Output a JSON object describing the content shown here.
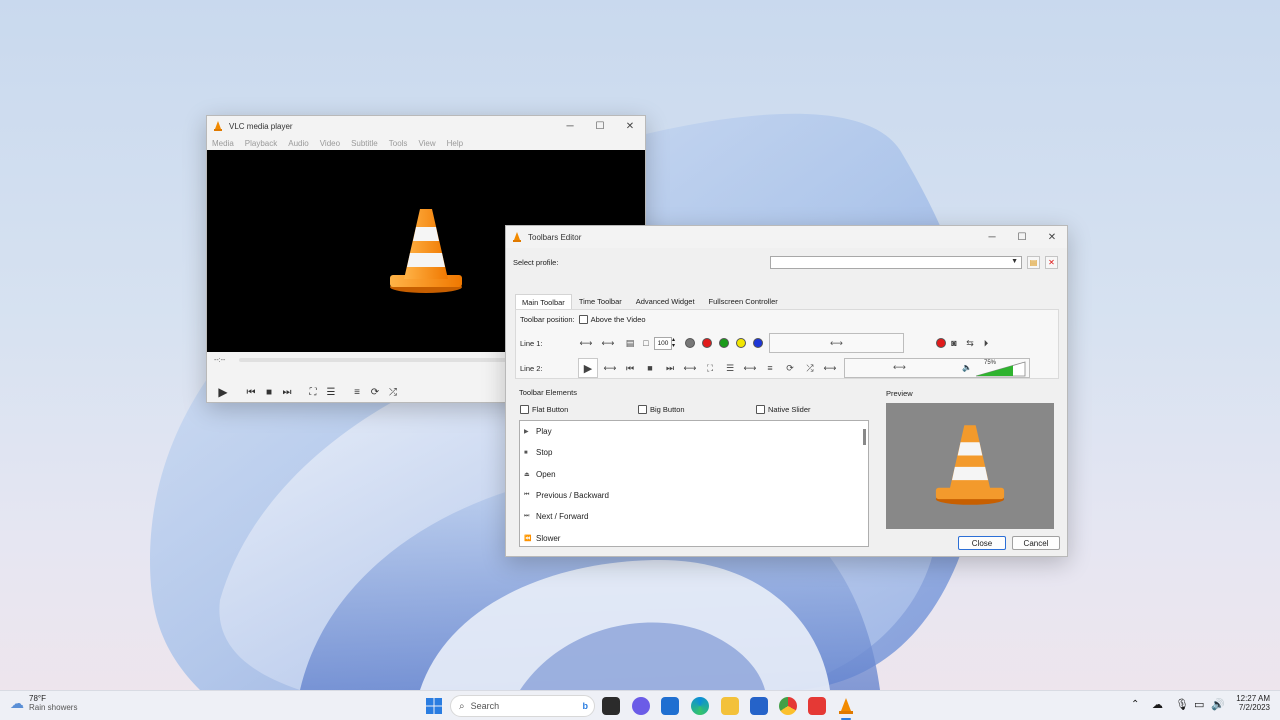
{
  "vlc": {
    "title": "VLC media player",
    "menu": [
      "Media",
      "Playback",
      "Audio",
      "Video",
      "Subtitle",
      "Tools",
      "View",
      "Help"
    ],
    "time": "--:--"
  },
  "editor": {
    "title": "Toolbars Editor",
    "select_profile_label": "Select profile:",
    "tabs": [
      "Main Toolbar",
      "Time Toolbar",
      "Advanced Widget",
      "Fullscreen Controller"
    ],
    "toolbar_position_label": "Toolbar position:",
    "above_video_label": "Above the Video",
    "line1_label": "Line 1:",
    "line2_label": "Line 2:",
    "zoom_value": "100",
    "volume_value": "75%",
    "elements_group_title": "Toolbar Elements",
    "flat_button_label": "Flat Button",
    "big_button_label": "Big Button",
    "native_slider_label": "Native Slider",
    "elements": [
      {
        "icon": "play-icon",
        "label": "Play"
      },
      {
        "icon": "stop-icon",
        "label": "Stop"
      },
      {
        "icon": "eject-icon",
        "label": "Open"
      },
      {
        "icon": "previous-icon",
        "label": "Previous / Backward"
      },
      {
        "icon": "next-icon",
        "label": "Next / Forward"
      },
      {
        "icon": "slower-icon",
        "label": "Slower"
      }
    ],
    "preview_label": "Preview",
    "close_label": "Close",
    "cancel_label": "Cancel",
    "dot_colors": [
      "#777777",
      "#e01b1b",
      "#1a9b1a",
      "#f2e600",
      "#1d36d6"
    ]
  },
  "taskbar": {
    "weather_temp": "78°F",
    "weather_desc": "Rain showers",
    "search_placeholder": "Search",
    "time": "12:27 AM",
    "date": "7/2/2023"
  }
}
